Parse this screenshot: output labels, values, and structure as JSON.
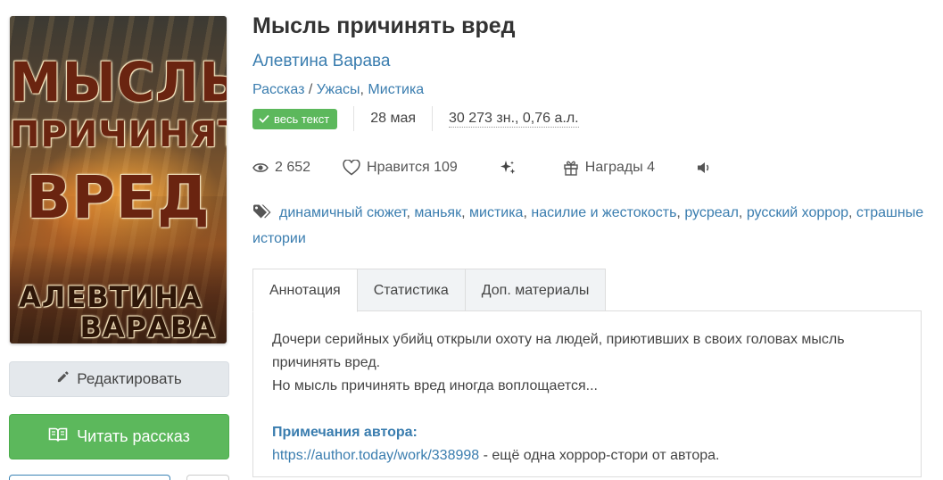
{
  "cover": {
    "title_line1": "МЫСЛЬ",
    "title_line2": "ПРИЧИНЯТЬ",
    "title_line3": "ВРЕД",
    "author_line1": "АЛЕВТИНА",
    "author_line2": "ВАРАВА"
  },
  "buttons": {
    "edit_label": "Редактировать",
    "read_label": "Читать рассказ"
  },
  "book": {
    "title": "Мысль причинять вред",
    "author": "Алевтина Варава",
    "genres": {
      "form": "Рассказ",
      "separator": " / ",
      "genre1": "Ужасы",
      "comma": ", ",
      "genre2": "Мистика"
    },
    "status_badge": "весь текст",
    "date": "28 мая",
    "size": "30 273 зн., 0,76 а.л."
  },
  "stats": {
    "views": "2 652",
    "likes_label": "Нравится 109",
    "awards_label": "Награды 4"
  },
  "tags": [
    "динамичный сюжет",
    "маньяк",
    "мистика",
    "насилие и жестокость",
    "русреал",
    "русский хоррор",
    "страшные истории"
  ],
  "tag_separator": ",",
  "tabs": [
    "Аннотация",
    "Статистика",
    "Доп. материалы"
  ],
  "annotation": {
    "line1": "Дочери серийных убийц открыли охоту на людей, приютивших в своих головах мысль причинять вред.",
    "line2": "Но мысль причинять вред иногда воплощается...",
    "notes_title": "Примечания автора:",
    "link": "https://author.today/work/338998",
    "link_suffix": " - ещё одна хоррор-стори от автора."
  },
  "colors": {
    "link": "#3a7daf",
    "green": "#5cb85c",
    "edit_bg": "#e4e8ec"
  },
  "icons": [
    "check-icon",
    "eye-icon",
    "heart-icon",
    "sparkle-icon",
    "gift-icon",
    "speaker-icon",
    "tags-icon",
    "pencil-icon",
    "book-open-icon"
  ]
}
